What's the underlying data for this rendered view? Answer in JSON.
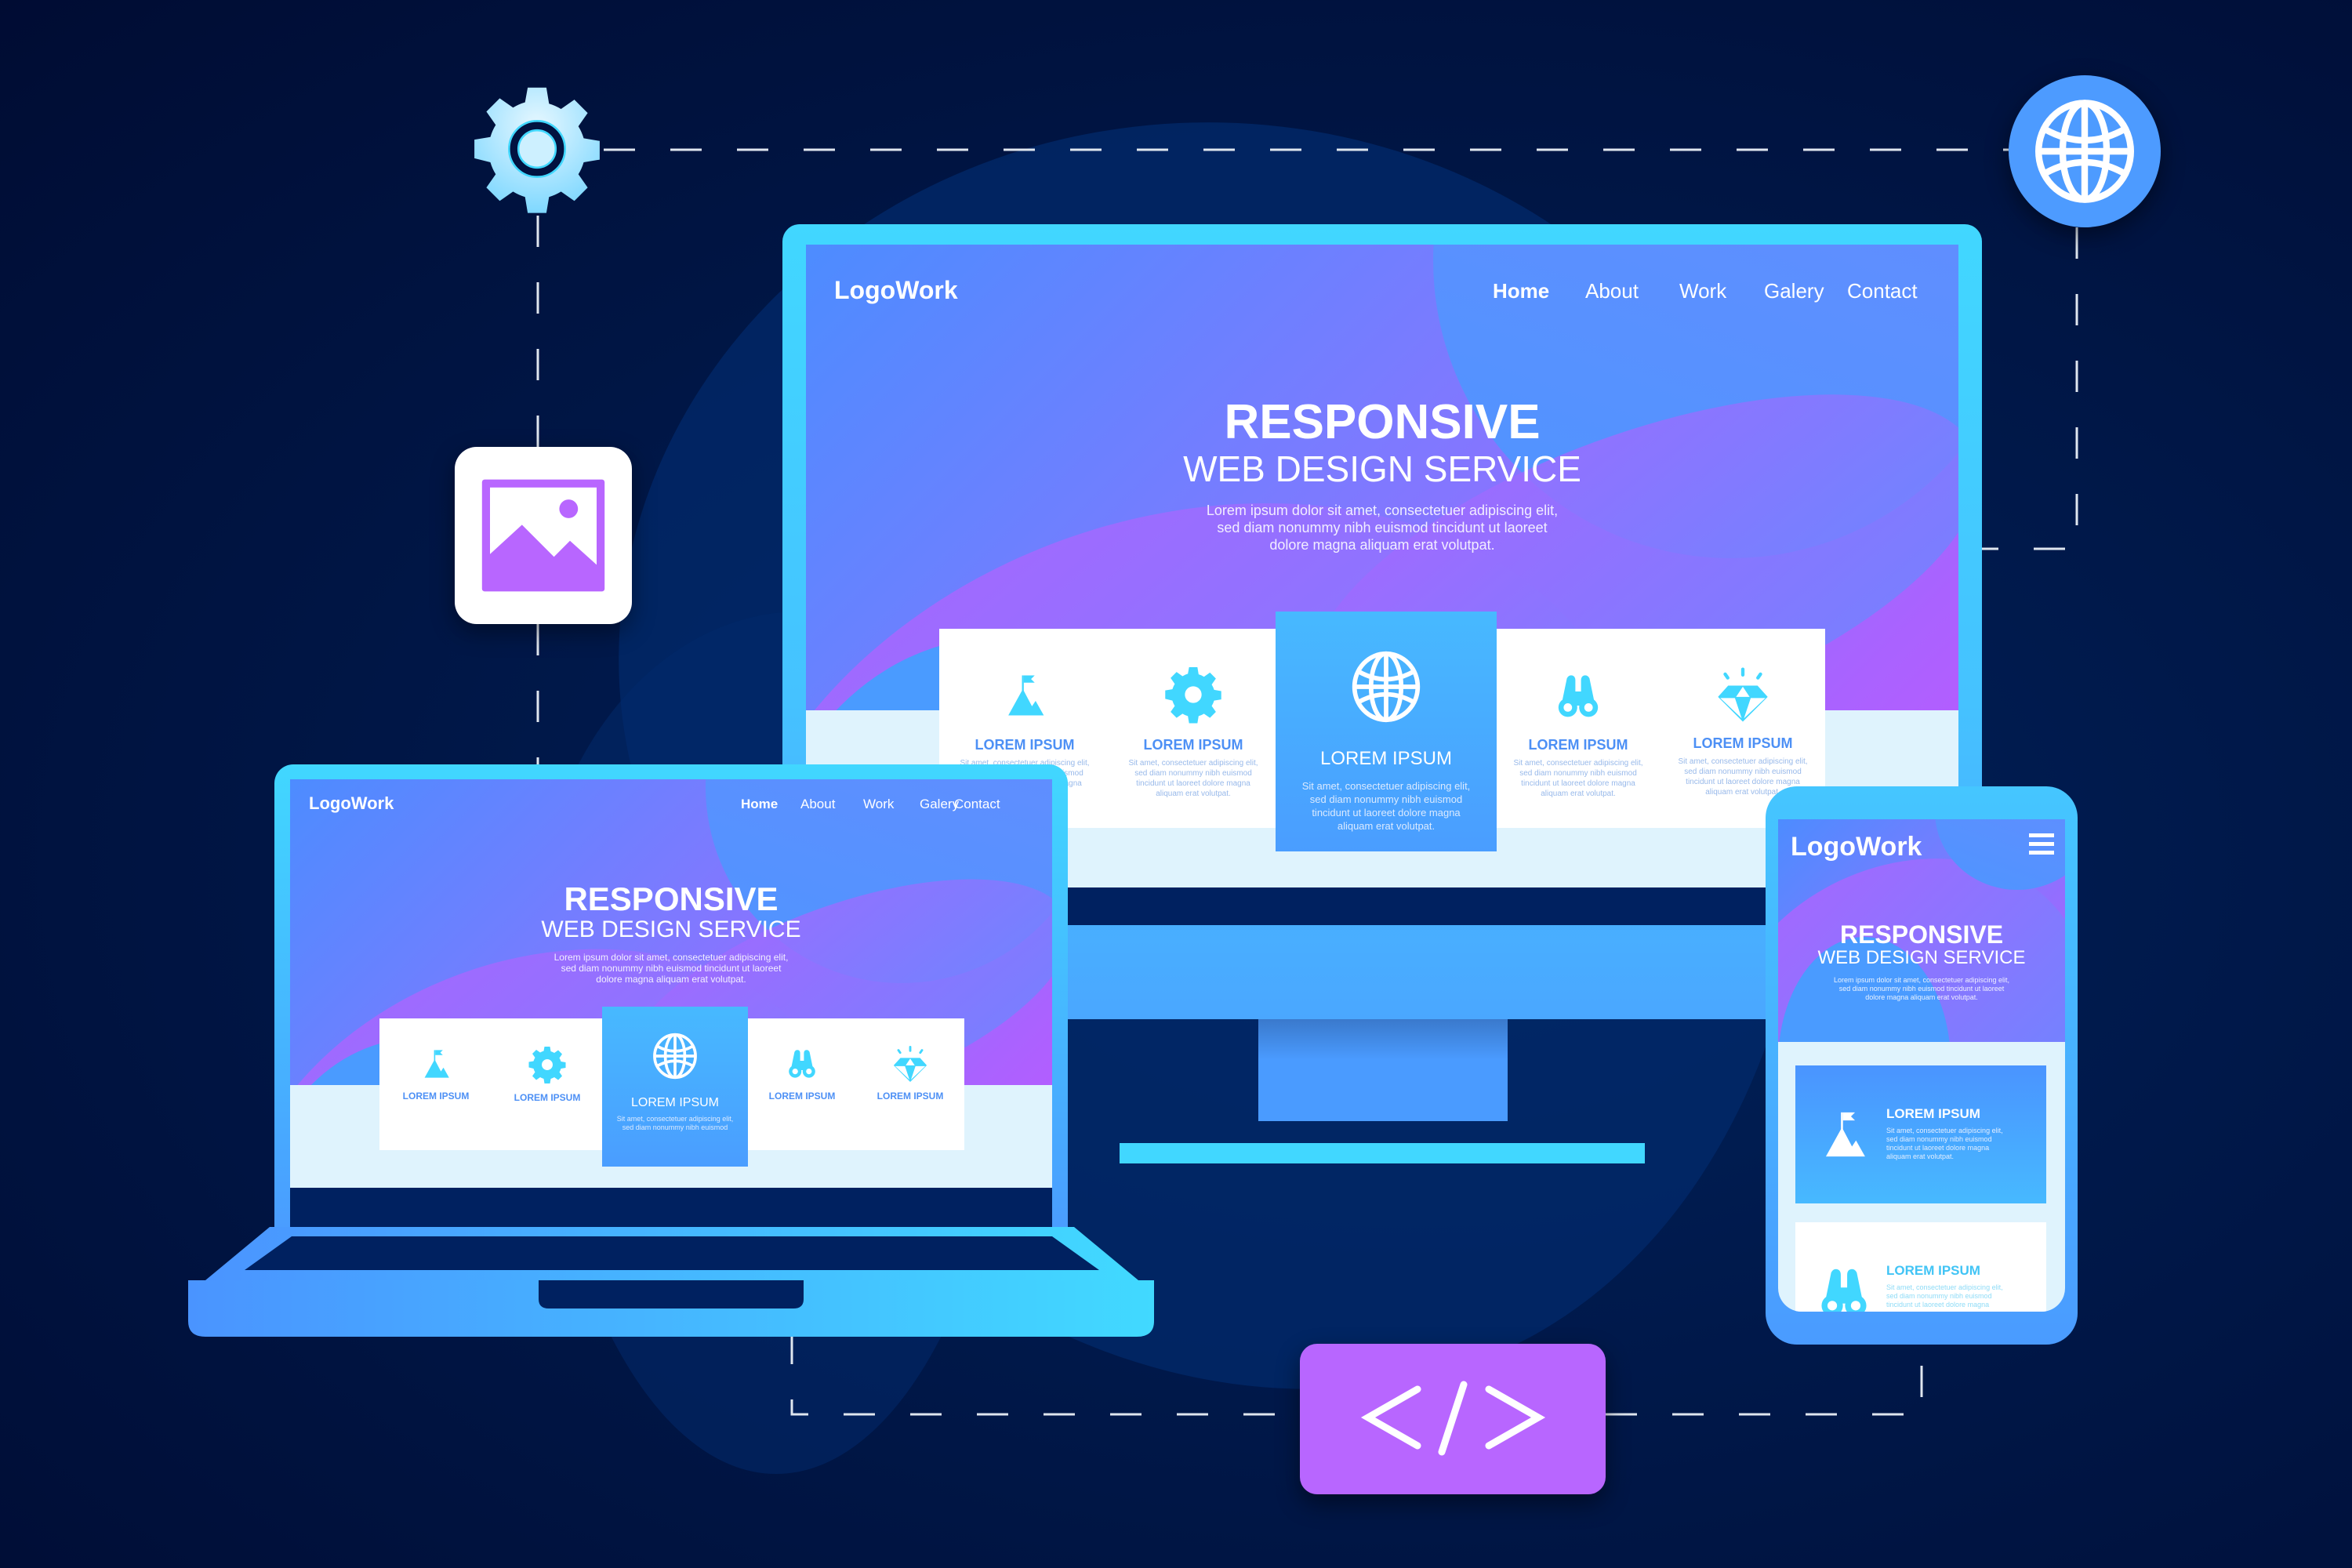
{
  "scene": {
    "title": "Responsive web design service illustration",
    "colors": {
      "background": "#001a4d",
      "accent_cyan": "#41d7ff",
      "accent_blue": "#4d9bff",
      "accent_purple": "#b866ff",
      "card_title": "#4d90f5",
      "pale_bg": "#dff3fd"
    }
  },
  "floating_icons": {
    "gear": "gear-icon",
    "globe": "globe-icon",
    "image": "image-icon",
    "code": "code-icon"
  },
  "site": {
    "logo": "LogoWork",
    "nav": [
      "Home",
      "About",
      "Work",
      "Galery",
      "Contact"
    ],
    "active_nav": "Home",
    "hero_title": "RESPONSIVE",
    "hero_subtitle": "WEB DESIGN SERVICE",
    "hero_desc_lines": [
      "Lorem ipsum dolor sit amet, consectetuer adipiscing elit,",
      "sed diam nonummy nibh euismod tincidunt ut laoreet",
      "dolore magna aliquam erat volutpat."
    ],
    "cards": [
      {
        "icon": "mountain-flag-icon",
        "title": "LOREM IPSUM",
        "text_lines": [
          "Sit amet, consectetuer adipiscing elit,",
          "sed diam nonummy nibh euismod",
          "tincidunt ut laoreet dolore magna",
          "aliquam erat volutpat."
        ]
      },
      {
        "icon": "gear-icon",
        "title": "LOREM IPSUM",
        "text_lines": [
          "Sit amet, consectetuer adipiscing elit,",
          "sed diam nonummy nibh euismod",
          "tincidunt ut laoreet dolore magna",
          "aliquam erat volutpat."
        ]
      },
      {
        "icon": "globe-icon",
        "title": "LOREM IPSUM",
        "featured": true,
        "text_lines": [
          "Sit amet, consectetuer adipiscing elit,",
          "sed diam nonummy nibh euismod",
          "tincidunt ut laoreet dolore magna",
          "aliquam erat volutpat."
        ]
      },
      {
        "icon": "binoculars-icon",
        "title": "LOREM IPSUM",
        "text_lines": [
          "Sit amet, consectetuer adipiscing elit,",
          "sed diam nonummy nibh euismod",
          "tincidunt ut laoreet dolore magna",
          "aliquam erat volutpat."
        ]
      },
      {
        "icon": "diamond-icon",
        "title": "LOREM IPSUM",
        "text_lines": [
          "Sit amet, consectetuer adipiscing elit,",
          "sed diam nonummy nibh euismod",
          "tincidunt ut laoreet dolore magna",
          "aliquam erat volutpat."
        ]
      }
    ]
  },
  "mobile": {
    "menu_icon": "hamburger-menu-icon",
    "cards": [
      {
        "icon": "mountain-flag-icon",
        "title": "LOREM IPSUM",
        "text_lines": [
          "Sit amet, consectetuer adipiscing elit,",
          "sed diam nonummy nibh euismod",
          "tincidunt ut laoreet dolore magna",
          "aliquam erat volutpat."
        ]
      },
      {
        "icon": "binoculars-icon",
        "title": "LOREM IPSUM",
        "text_lines": [
          "Sit amet, consectetuer adipiscing elit,",
          "sed diam nonummy nibh euismod",
          "tincidunt ut laoreet dolore magna"
        ]
      }
    ]
  }
}
